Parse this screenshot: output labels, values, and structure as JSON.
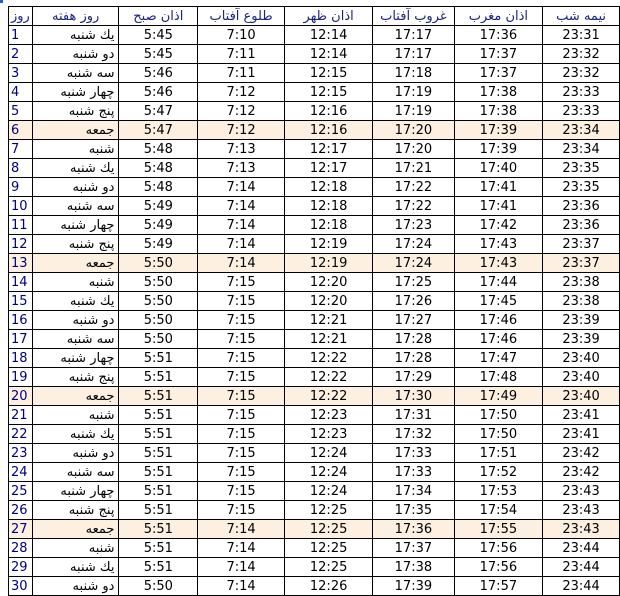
{
  "colors": {
    "header_text": "#1a237e",
    "day_number_text": "#000080",
    "friday_row_bg": "#fdf0e0",
    "border": "#000000"
  },
  "headers": [
    "روز",
    "روز هفته",
    "اذان صبح",
    "طلوع آفتاب",
    "اذان ظهر",
    "غروب آفتاب",
    "اذان مغرب",
    "نیمه شب"
  ],
  "rows": [
    {
      "day": "1",
      "weekday": "یك شنبه",
      "fajr": "5:45",
      "sunrise": "7:10",
      "dhuhr": "12:14",
      "sunset": "17:17",
      "maghrib": "17:36",
      "midnight": "23:31",
      "friday": false
    },
    {
      "day": "2",
      "weekday": "دو شنبه",
      "fajr": "5:45",
      "sunrise": "7:11",
      "dhuhr": "12:14",
      "sunset": "17:17",
      "maghrib": "17:37",
      "midnight": "23:32",
      "friday": false
    },
    {
      "day": "3",
      "weekday": "سه شنبه",
      "fajr": "5:46",
      "sunrise": "7:11",
      "dhuhr": "12:15",
      "sunset": "17:18",
      "maghrib": "17:37",
      "midnight": "23:32",
      "friday": false
    },
    {
      "day": "4",
      "weekday": "چهار شنبه",
      "fajr": "5:46",
      "sunrise": "7:12",
      "dhuhr": "12:15",
      "sunset": "17:19",
      "maghrib": "17:38",
      "midnight": "23:33",
      "friday": false
    },
    {
      "day": "5",
      "weekday": "پنج شنبه",
      "fajr": "5:47",
      "sunrise": "7:12",
      "dhuhr": "12:16",
      "sunset": "17:19",
      "maghrib": "17:38",
      "midnight": "23:33",
      "friday": false
    },
    {
      "day": "6",
      "weekday": "جمعه",
      "fajr": "5:47",
      "sunrise": "7:12",
      "dhuhr": "12:16",
      "sunset": "17:20",
      "maghrib": "17:39",
      "midnight": "23:34",
      "friday": true
    },
    {
      "day": "7",
      "weekday": "شنبه",
      "fajr": "5:48",
      "sunrise": "7:13",
      "dhuhr": "12:17",
      "sunset": "17:20",
      "maghrib": "17:39",
      "midnight": "23:34",
      "friday": false
    },
    {
      "day": "8",
      "weekday": "یك شنبه",
      "fajr": "5:48",
      "sunrise": "7:13",
      "dhuhr": "12:17",
      "sunset": "17:21",
      "maghrib": "17:40",
      "midnight": "23:35",
      "friday": false
    },
    {
      "day": "9",
      "weekday": "دو شنبه",
      "fajr": "5:48",
      "sunrise": "7:14",
      "dhuhr": "12:18",
      "sunset": "17:22",
      "maghrib": "17:41",
      "midnight": "23:35",
      "friday": false
    },
    {
      "day": "10",
      "weekday": "سه شنبه",
      "fajr": "5:49",
      "sunrise": "7:14",
      "dhuhr": "12:18",
      "sunset": "17:22",
      "maghrib": "17:41",
      "midnight": "23:36",
      "friday": false
    },
    {
      "day": "11",
      "weekday": "چهار شنبه",
      "fajr": "5:49",
      "sunrise": "7:14",
      "dhuhr": "12:18",
      "sunset": "17:23",
      "maghrib": "17:42",
      "midnight": "23:36",
      "friday": false
    },
    {
      "day": "12",
      "weekday": "پنج شنبه",
      "fajr": "5:49",
      "sunrise": "7:14",
      "dhuhr": "12:19",
      "sunset": "17:24",
      "maghrib": "17:43",
      "midnight": "23:37",
      "friday": false
    },
    {
      "day": "13",
      "weekday": "جمعه",
      "fajr": "5:50",
      "sunrise": "7:14",
      "dhuhr": "12:19",
      "sunset": "17:24",
      "maghrib": "17:43",
      "midnight": "23:37",
      "friday": true
    },
    {
      "day": "14",
      "weekday": "شنبه",
      "fajr": "5:50",
      "sunrise": "7:15",
      "dhuhr": "12:20",
      "sunset": "17:25",
      "maghrib": "17:44",
      "midnight": "23:38",
      "friday": false
    },
    {
      "day": "15",
      "weekday": "یك شنبه",
      "fajr": "5:50",
      "sunrise": "7:15",
      "dhuhr": "12:20",
      "sunset": "17:26",
      "maghrib": "17:45",
      "midnight": "23:38",
      "friday": false
    },
    {
      "day": "16",
      "weekday": "دو شنبه",
      "fajr": "5:50",
      "sunrise": "7:15",
      "dhuhr": "12:21",
      "sunset": "17:27",
      "maghrib": "17:46",
      "midnight": "23:39",
      "friday": false
    },
    {
      "day": "17",
      "weekday": "سه شنبه",
      "fajr": "5:50",
      "sunrise": "7:15",
      "dhuhr": "12:21",
      "sunset": "17:28",
      "maghrib": "17:46",
      "midnight": "23:39",
      "friday": false
    },
    {
      "day": "18",
      "weekday": "چهار شنبه",
      "fajr": "5:51",
      "sunrise": "7:15",
      "dhuhr": "12:22",
      "sunset": "17:28",
      "maghrib": "17:47",
      "midnight": "23:40",
      "friday": false
    },
    {
      "day": "19",
      "weekday": "پنج شنبه",
      "fajr": "5:51",
      "sunrise": "7:15",
      "dhuhr": "12:22",
      "sunset": "17:29",
      "maghrib": "17:48",
      "midnight": "23:40",
      "friday": false
    },
    {
      "day": "20",
      "weekday": "جمعه",
      "fajr": "5:51",
      "sunrise": "7:15",
      "dhuhr": "12:22",
      "sunset": "17:30",
      "maghrib": "17:49",
      "midnight": "23:40",
      "friday": true
    },
    {
      "day": "21",
      "weekday": "شنبه",
      "fajr": "5:51",
      "sunrise": "7:15",
      "dhuhr": "12:23",
      "sunset": "17:31",
      "maghrib": "17:50",
      "midnight": "23:41",
      "friday": false
    },
    {
      "day": "22",
      "weekday": "یك شنبه",
      "fajr": "5:51",
      "sunrise": "7:15",
      "dhuhr": "12:23",
      "sunset": "17:32",
      "maghrib": "17:50",
      "midnight": "23:41",
      "friday": false
    },
    {
      "day": "23",
      "weekday": "دو شنبه",
      "fajr": "5:51",
      "sunrise": "7:15",
      "dhuhr": "12:24",
      "sunset": "17:33",
      "maghrib": "17:51",
      "midnight": "23:42",
      "friday": false
    },
    {
      "day": "24",
      "weekday": "سه شنبه",
      "fajr": "5:51",
      "sunrise": "7:15",
      "dhuhr": "12:24",
      "sunset": "17:33",
      "maghrib": "17:52",
      "midnight": "23:42",
      "friday": false
    },
    {
      "day": "25",
      "weekday": "چهار شنبه",
      "fajr": "5:51",
      "sunrise": "7:15",
      "dhuhr": "12:24",
      "sunset": "17:34",
      "maghrib": "17:53",
      "midnight": "23:43",
      "friday": false
    },
    {
      "day": "26",
      "weekday": "پنج شنبه",
      "fajr": "5:51",
      "sunrise": "7:15",
      "dhuhr": "12:25",
      "sunset": "17:35",
      "maghrib": "17:54",
      "midnight": "23:43",
      "friday": false
    },
    {
      "day": "27",
      "weekday": "جمعه",
      "fajr": "5:51",
      "sunrise": "7:14",
      "dhuhr": "12:25",
      "sunset": "17:36",
      "maghrib": "17:55",
      "midnight": "23:43",
      "friday": true
    },
    {
      "day": "28",
      "weekday": "شنبه",
      "fajr": "5:51",
      "sunrise": "7:14",
      "dhuhr": "12:25",
      "sunset": "17:37",
      "maghrib": "17:56",
      "midnight": "23:44",
      "friday": false
    },
    {
      "day": "29",
      "weekday": "یك شنبه",
      "fajr": "5:51",
      "sunrise": "7:14",
      "dhuhr": "12:25",
      "sunset": "17:38",
      "maghrib": "17:56",
      "midnight": "23:44",
      "friday": false
    },
    {
      "day": "30",
      "weekday": "دو شنبه",
      "fajr": "5:50",
      "sunrise": "7:14",
      "dhuhr": "12:26",
      "sunset": "17:39",
      "maghrib": "17:57",
      "midnight": "23:44",
      "friday": false
    }
  ]
}
